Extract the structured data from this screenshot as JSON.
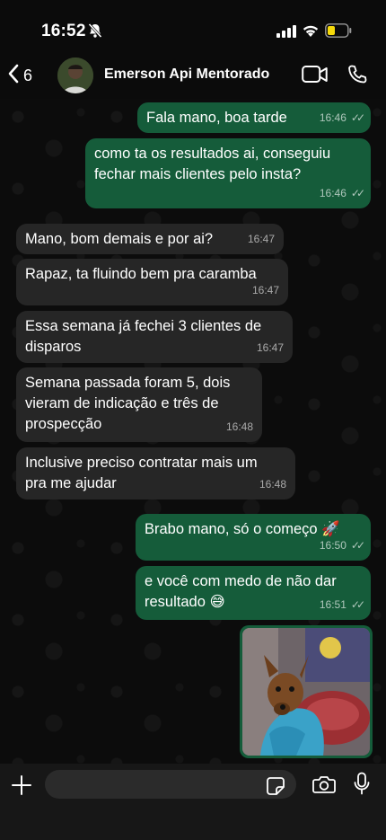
{
  "status_bar": {
    "time": "16:52",
    "icons": [
      "bell-slash-icon",
      "signal-icon",
      "wifi-icon",
      "battery-low-icon"
    ]
  },
  "header": {
    "back_count": "6",
    "contact_name": "Emerson Api Mentorado",
    "icons": [
      "chevron-left-icon",
      "video-camera-icon",
      "phone-icon"
    ]
  },
  "messages": [
    {
      "direction": "out",
      "text": "Fala mano, boa tarde",
      "time": "16:46",
      "read": true
    },
    {
      "direction": "out",
      "text": "como ta os resultados ai, conseguiu\nfechar mais clientes pelo insta?",
      "time": "16:46",
      "read": true
    },
    {
      "direction": "in",
      "text": "Mano, bom demais e por ai?",
      "time": "16:47"
    },
    {
      "direction": "in",
      "text": "Rapaz, ta fluindo bem pra caramba",
      "time": "16:47"
    },
    {
      "direction": "in",
      "text": "Essa semana já fechei 3 clientes de\ndisparos",
      "time": "16:47"
    },
    {
      "direction": "in",
      "text": "Semana passada foram 5, dois\nvieram de indicação e três de\nprospecção",
      "time": "16:48"
    },
    {
      "direction": "in",
      "text": "Inclusive preciso contratar mais um\npra me ajudar",
      "time": "16:48"
    },
    {
      "direction": "out",
      "text": "Brabo mano, só o começo 🚀",
      "time": "16:50",
      "read": true
    },
    {
      "direction": "out",
      "text": "e você com medo de não dar\nresultado 😅",
      "time": "16:51",
      "read": true
    },
    {
      "direction": "out",
      "type": "image",
      "depicts": "small dog in blue clothing"
    }
  ],
  "input_bar": {
    "placeholder": "",
    "icons": [
      "plus-icon",
      "sticker-icon",
      "camera-icon",
      "microphone-icon"
    ]
  },
  "colors": {
    "background": "#0b0b0b",
    "incoming_bubble": "#262626",
    "outgoing_bubble": "#155c3a",
    "input_bar": "#171717"
  }
}
